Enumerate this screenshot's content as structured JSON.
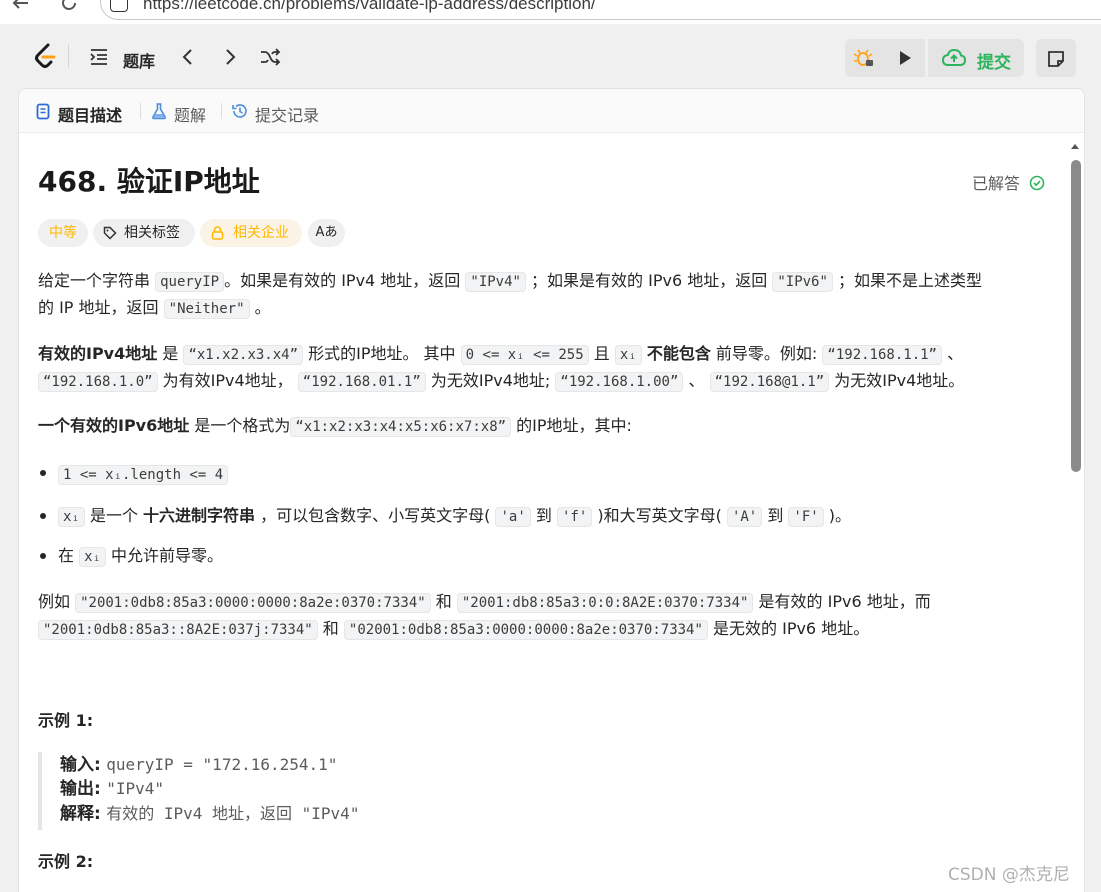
{
  "browser": {
    "url": "https://leetcode.cn/problems/validate-ip-address/description/"
  },
  "topnav": {
    "problem_list_label": "题库",
    "submit_label": "提交"
  },
  "tabs": [
    {
      "label": "题目描述"
    },
    {
      "label": "题解"
    },
    {
      "label": "提交记录"
    }
  ],
  "problem": {
    "title": "468. 验证IP地址",
    "status": "已解答",
    "difficulty": "中等",
    "tags_label": "相关标签",
    "companies_label": "相关企业",
    "font_toggle": "Aあ"
  },
  "description": {
    "p1": {
      "t1": "给定一个字符串 ",
      "c1": "queryIP",
      "t2": "。如果是有效的 IPv4 地址，返回 ",
      "c2": "\"IPv4\"",
      "t3": " ；如果是有效的 IPv6 地址，返回 ",
      "c3": "\"IPv6\"",
      "t4": " ；如果不是上述类型",
      "t5": "的 IP 地址，返回 ",
      "c4": "\"Neither\"",
      "t6": " 。"
    },
    "p2": {
      "b1": "有效的IPv4地址",
      "t1": " 是 ",
      "c1": "“x1.x2.x3.x4”",
      "t2": " 形式的IP地址。 其中 ",
      "c2": "0 <= xᵢ <= 255",
      "t3": " 且 ",
      "c3": "xᵢ",
      "t4": " ",
      "b2": "不能包含",
      "t5": " 前导零。例如: ",
      "c4": "“192.168.1.1”",
      "t6": " 、",
      "c5": "“192.168.1.0”",
      "t7": " 为有效IPv4地址， ",
      "c6": "“192.168.01.1”",
      "t8": " 为无效IPv4地址; ",
      "c7": "“192.168.1.00”",
      "t9": " 、 ",
      "c8": "“192.168@1.1”",
      "t10": " 为无效IPv4地址。"
    },
    "p3": {
      "b1": "一个有效的IPv6地址",
      "t1": " 是一个格式为",
      "c1": "“x1:x2:x3:x4:x5:x6:x7:x8”",
      "t2": " 的IP地址，其中:"
    },
    "bullets": {
      "b1_code": "1 <= xᵢ.length <= 4",
      "b2_c1": "xᵢ",
      "b2_t1": " 是一个 ",
      "b2_b1": "十六进制字符串",
      "b2_t2": " ，可以包含数字、小写英文字母( ",
      "b2_c2": "'a'",
      "b2_t3": " 到 ",
      "b2_c3": "'f'",
      "b2_t4": " )和大写英文字母( ",
      "b2_c4": "'A'",
      "b2_t5": " 到 ",
      "b2_c5": "'F'",
      "b2_t6": " )。",
      "b3_t1": "在 ",
      "b3_c1": "xᵢ",
      "b3_t2": " 中允许前导零。"
    },
    "p4": {
      "t1": "例如 ",
      "c1": "\"2001:0db8:85a3:0000:0000:8a2e:0370:7334\"",
      "t2": " 和 ",
      "c2": "\"2001:db8:85a3:0:0:8A2E:0370:7334\"",
      "t3": " 是有效的 IPv6 地址，而",
      "c3": "\"2001:0db8:85a3::8A2E:037j:7334\"",
      "t4": " 和 ",
      "c4": "\"02001:0db8:85a3:0000:0000:8a2e:0370:7334\"",
      "t5": " 是无效的 IPv6 地址。"
    }
  },
  "examples": [
    {
      "heading": "示例 1:",
      "input_label": "输入:",
      "input_value": "queryIP = \"172.16.254.1\"",
      "output_label": "输出:",
      "output_value": "\"IPv4\"",
      "explain_label": "解释:",
      "explain_value": "有效的 IPv4 地址，返回 \"IPv4\""
    },
    {
      "heading": "示例 2:"
    }
  ],
  "watermark": "CSDN @杰克尼",
  "colors": {
    "accent_green": "#2db55d",
    "difficulty_orange": "#ffb800"
  }
}
